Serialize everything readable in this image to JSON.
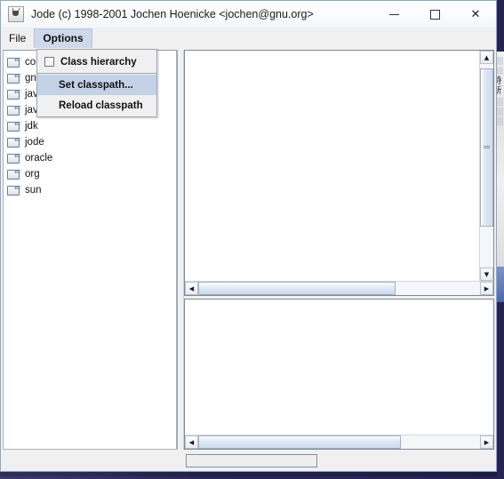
{
  "window": {
    "title": "Jode (c) 1998-2001 Jochen Hoenicke <jochen@gnu.org>",
    "app_icon": "java-coffee-cup-icon",
    "controls": {
      "minimize_label": "–",
      "maximize_label": "□",
      "close_label": "✕"
    }
  },
  "menubar": {
    "items": [
      {
        "label": "File",
        "open": false
      },
      {
        "label": "Options",
        "open": true
      }
    ]
  },
  "dropdown": {
    "owner": "Options",
    "items": [
      {
        "label": "Class hierarchy",
        "type": "checkbox",
        "checked": false,
        "selected": false
      },
      {
        "label": "Set classpath...",
        "type": "item",
        "selected": true
      },
      {
        "label": "Reload classpath",
        "type": "item",
        "selected": false
      }
    ]
  },
  "tree": {
    "items": [
      {
        "label": "com",
        "icon": "folder-icon"
      },
      {
        "label": "gnu",
        "icon": "folder-icon"
      },
      {
        "label": "java",
        "icon": "folder-icon"
      },
      {
        "label": "javax",
        "icon": "folder-icon"
      },
      {
        "label": "jdk",
        "icon": "folder-icon"
      },
      {
        "label": "jode",
        "icon": "folder-icon"
      },
      {
        "label": "oracle",
        "icon": "folder-icon"
      },
      {
        "label": "org",
        "icon": "folder-icon"
      },
      {
        "label": "sun",
        "icon": "folder-icon"
      }
    ]
  },
  "editor_top": {
    "content": "",
    "vscroll": {
      "up_arrow": "▲",
      "down_arrow": "▼",
      "thumb_top_pct": 2,
      "thumb_height_pct": 78
    },
    "hscroll": {
      "left_arrow": "◀",
      "right_arrow": "▶",
      "thumb_left_pct": 0,
      "thumb_width_pct": 70
    }
  },
  "editor_bottom": {
    "content": "",
    "hscroll": {
      "left_arrow": "◀",
      "right_arrow": "▶",
      "thumb_left_pct": 0,
      "thumb_width_pct": 72
    }
  },
  "statusbar": {
    "field_value": ""
  },
  "colors": {
    "accent": "#c3d2e6",
    "menu_open_bg": "#cdd9ea",
    "window_border": "#8ea8c8",
    "panel_bg": "#f0f0f0",
    "desktop": "#2b2857"
  }
}
